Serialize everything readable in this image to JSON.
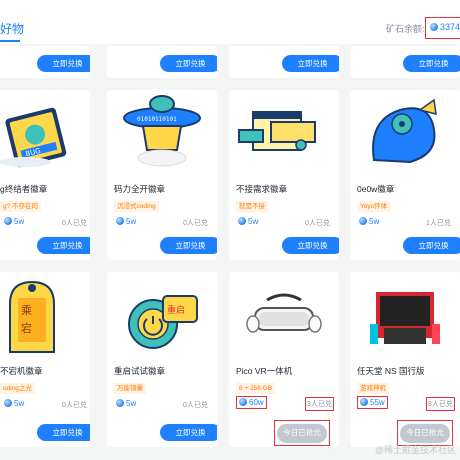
{
  "header": {
    "title": "好物",
    "balance_label": "矿石余额:",
    "balance_value": "3374"
  },
  "top_row": {
    "buttons": [
      "立即兑换",
      "立即兑换",
      "立即兑换",
      "立即兑换"
    ]
  },
  "cards": [
    {
      "name": "g终结者徽章",
      "tag": "g? 不存在的",
      "price": "5w",
      "sold": "0人已兑",
      "button": "立即兑换"
    },
    {
      "name": "码力全开徽章",
      "tag": "沉浸式coding",
      "price": "5w",
      "sold": "0人已兑",
      "button": "立即兑换"
    },
    {
      "name": "不接需求徽章",
      "tag": "就是不接",
      "price": "5w",
      "sold": "0人已兑",
      "button": "立即兑换"
    },
    {
      "name": "0e0w徽章",
      "tag": "Yoyo怀体",
      "price": "5w",
      "sold": "1人已兑",
      "button": "立即兑换"
    },
    {
      "name": "不宕机徽章",
      "tag": "oding之光",
      "price": "5w",
      "sold": "0人已兑",
      "button": "立即兑换"
    },
    {
      "name": "重启试试徽章",
      "tag": "万能锦囊",
      "price": "5w",
      "sold": "0人已兑",
      "button": "立即兑换"
    },
    {
      "name": "Pico VR一体机",
      "tag": "6 + 256 GB",
      "price": "60w",
      "sold": "3人已兑",
      "button": "今日已抢光"
    },
    {
      "name": "任天堂 NS 国行版",
      "tag": "游戏神机",
      "price": "55w",
      "sold": "8人已兑",
      "button": "今日已抢光"
    }
  ],
  "watermark": "@稀土掘金技术社区",
  "colors": {
    "accent": "#1e80ff",
    "tag_text": "#ff7d00",
    "highlight": "#e8313b",
    "disabled": "#c2c8d1"
  }
}
